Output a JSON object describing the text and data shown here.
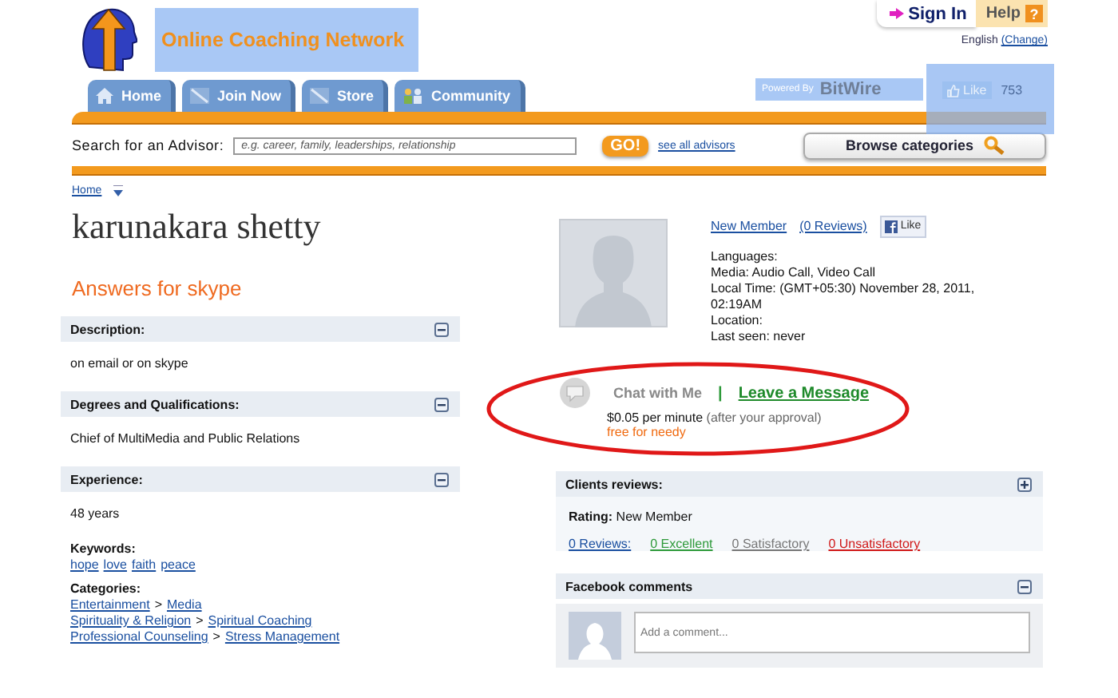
{
  "header": {
    "site_title": "Online Coaching Network",
    "sign_in": "Sign In",
    "help": "Help",
    "help_badge": "?",
    "language": "English",
    "change_link": "(Change)"
  },
  "nav": {
    "tabs": [
      {
        "label": "Home",
        "kind": "house",
        "selected": false
      },
      {
        "label": "Join Now",
        "kind": "page",
        "selected": false
      },
      {
        "label": "Store",
        "kind": "page",
        "selected": false
      },
      {
        "label": "Community",
        "kind": "people",
        "selected": false
      }
    ],
    "powered_by": "Powered By",
    "brand": "BitWire",
    "like": "Like",
    "like_count": "753"
  },
  "search": {
    "label": "Search for an Advisor:",
    "placeholder": "e.g. career, family, leaderships, relationship",
    "go": "GO!",
    "see_all": "see all advisors",
    "browse": "Browse categories"
  },
  "breadcrumb": [
    "Home"
  ],
  "profile": {
    "name": "karunakara shetty",
    "subtitle": "Answers for skype",
    "sections": [
      {
        "title": "Description:",
        "expanded": true,
        "text": "on email or on skype"
      },
      {
        "title": "Degrees and Qualifications:",
        "expanded": true,
        "text": "Chief of MultiMedia and Public Relations"
      },
      {
        "title": "Experience:",
        "expanded": true,
        "text": "48 years"
      }
    ],
    "keywords_label": "Keywords:",
    "keywords": [
      "hope",
      "love",
      "faith",
      "peace"
    ],
    "categories_label": "Categories:",
    "categories": [
      {
        "parent": "Entertainment",
        "separator": ">",
        "child": "Media"
      },
      {
        "parent": "Spirituality & Religion",
        "separator": ">",
        "child": "Spiritual Coaching"
      },
      {
        "parent": "Professional Counseling",
        "separator": ">",
        "child": "Stress Management"
      }
    ]
  },
  "advisor": {
    "status": "New Member",
    "reviews_link": "(0 Reviews)",
    "fb_like": "Like",
    "details": [
      "Languages:",
      "Media: Audio Call, Video Call",
      "Local Time: (GMT+05:30) November 28, 2011, 02:19AM",
      "Location:",
      "Last seen: never"
    ],
    "chat": "Chat with Me",
    "separator": "|",
    "leave_message": "Leave a Message",
    "price": "$0.05 per minute",
    "price_note": "(after your approval)",
    "free_note": "free for needy"
  },
  "reviews": {
    "title": "Clients reviews:",
    "expanded": false,
    "rating_label": "Rating:",
    "rating": "New Member",
    "links": [
      {
        "label": "0 Reviews:",
        "color": "#1a4fa0"
      },
      {
        "label": "0 Excellent",
        "color": "#2e9a3a"
      },
      {
        "label": "0 Satisfactory",
        "color": "#777777"
      },
      {
        "label": "0 Unsatisfactory",
        "color": "#d01818"
      }
    ]
  },
  "comments": {
    "title": "Facebook comments",
    "expanded": true,
    "placeholder": "Add a comment..."
  }
}
